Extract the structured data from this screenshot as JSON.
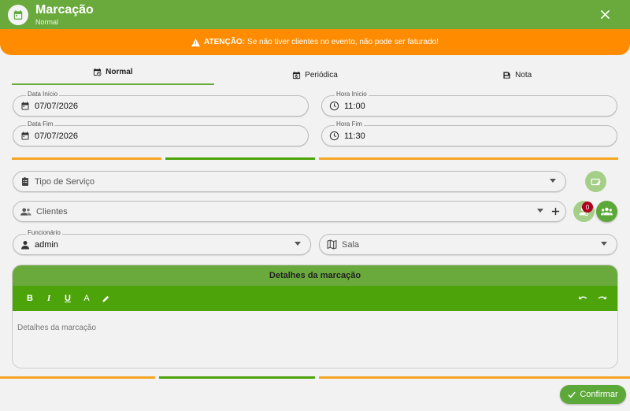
{
  "header": {
    "title": "Marcação",
    "subtitle": "Normal"
  },
  "warning": {
    "prefix": "ATENÇÃO:",
    "text": "Se não tiver clientes no evento, não pode ser faturado!"
  },
  "tabs": [
    {
      "label": "Normal",
      "icon": "calendar-clock-icon"
    },
    {
      "label": "Periódica",
      "icon": "calendar-repeat-icon"
    },
    {
      "label": "Nota",
      "icon": "note-icon"
    }
  ],
  "fields": {
    "start_date": {
      "label": "Data Início",
      "value": "07/07/2026"
    },
    "start_time": {
      "label": "Hora Início",
      "value": "11:00"
    },
    "end_date": {
      "label": "Data Fim",
      "value": "07/07/2026"
    },
    "end_time": {
      "label": "Hora Fim",
      "value": "11:30"
    },
    "service_type": {
      "placeholder": "Tipo de Serviço"
    },
    "clients": {
      "placeholder": "Clientes",
      "count": "0"
    },
    "employee": {
      "label": "Funcionário",
      "value": "admin"
    },
    "room": {
      "placeholder": "Sala"
    }
  },
  "editor": {
    "title": "Detalhes da marcação",
    "placeholder": "Detalhes da marcação",
    "tools": {
      "bold": "B",
      "italic": "I",
      "underline": "U",
      "color": "A"
    }
  },
  "footer": {
    "confirm_label": "Confirmar"
  },
  "colors": {
    "primary": "#6aaa3c",
    "toolbar": "#4ca30a",
    "warning": "#ff8c00",
    "accent": "#f5a623"
  }
}
